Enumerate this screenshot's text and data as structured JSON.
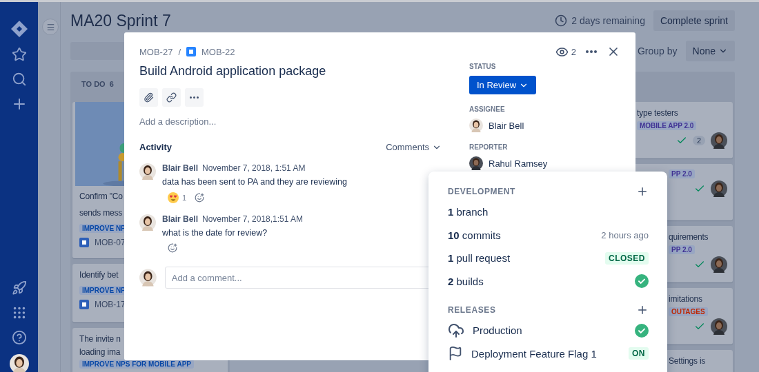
{
  "board": {
    "title": "MA20 Sprint 7",
    "time_remaining": "2 days remaining",
    "complete_button": "Complete sprint",
    "group_by_label": "Group by",
    "group_by_value": "None",
    "todo_column": {
      "title": "TO DO",
      "count": "6",
      "cards": [
        {
          "has_picture": true,
          "lines": [
            "Confirm \"Co",
            "sends mess"
          ],
          "tag": "IMPROVE NP",
          "color": "#0747a6",
          "key": "MOB-07"
        },
        {
          "has_picture": false,
          "lines": [
            "Identify bet"
          ],
          "tag": "IMPROVE NP",
          "color": "#0747a6",
          "key": "MOB-17"
        },
        {
          "has_picture": false,
          "lines": [
            "The invite n",
            "loading ima"
          ],
          "tag": "IMPROVE NPS FOR MOBILE APP",
          "color": "#0747a6"
        }
      ]
    },
    "right_column": {
      "cards": [
        {
          "lines": [
            "type testers"
          ],
          "tag": "MOBILE APP 2.0",
          "color": "#403294",
          "done": true,
          "count": "2"
        },
        {
          "tag": "PP 2.0",
          "color": "#403294",
          "done": true
        },
        {
          "lines": [
            "quirements"
          ],
          "tag": "PP 2.0",
          "color": "#403294",
          "done": true
        },
        {
          "lines": [
            "imitations"
          ],
          "tag": "OUTAGES",
          "color": "#bf2600",
          "done": true
        },
        {
          "lines": [
            "Settings is"
          ]
        }
      ]
    }
  },
  "issue": {
    "breadcrumb": {
      "parent": "MOB-27",
      "separator": "/",
      "key": "MOB-22"
    },
    "watchers": "2",
    "title": "Build Android application package",
    "description_placeholder": "Add a description...",
    "activity_title": "Activity",
    "activity_filter": "Comments",
    "comments": [
      {
        "author": "Blair Bell",
        "date": "November 7, 2018, 1:51 AM",
        "body": "data has been sent to PA and they are reviewing",
        "reactions": [
          {
            "count": "1"
          }
        ]
      },
      {
        "author": "Blair Bell",
        "date": "November 7, 2018,1:51 AM",
        "body": "what is the date for review?"
      }
    ],
    "comment_placeholder": "Add a comment...",
    "status": {
      "label": "STATUS",
      "value": "In Review"
    },
    "assignee": {
      "label": "ASSIGNEE",
      "name": "Blair Bell"
    },
    "reporter": {
      "label": "REPORTER",
      "name": "Rahul Ramsey"
    }
  },
  "dev_panel": {
    "development": {
      "title": "DEVELOPMENT",
      "items": [
        {
          "kind": "plain",
          "text": "**1** branch"
        },
        {
          "kind": "meta",
          "text": "**10** commits",
          "meta": "2 hours ago"
        },
        {
          "kind": "lozenge",
          "text": "**1** pull request",
          "badge": "CLOSED"
        },
        {
          "kind": "success",
          "text": "**2** builds"
        }
      ]
    },
    "releases": {
      "title": "RELEASES",
      "items": [
        {
          "kind": "environment",
          "label": "Production"
        },
        {
          "kind": "feature_flag",
          "label": "Deployment Feature Flag 1",
          "badge": "ON"
        }
      ]
    }
  }
}
